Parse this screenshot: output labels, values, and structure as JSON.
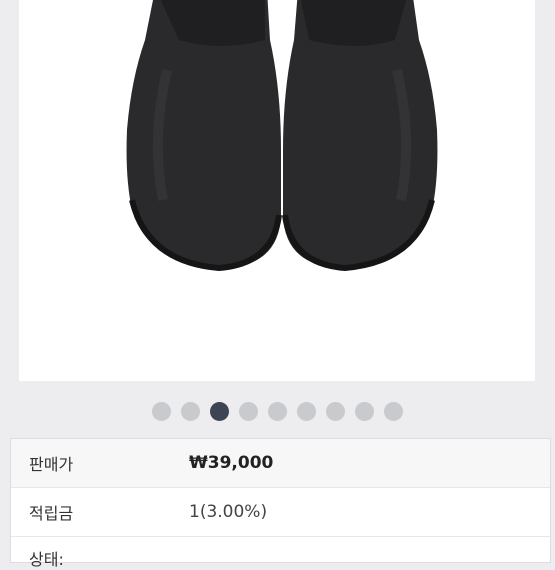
{
  "gallery": {
    "image_alt": "black chelsea boots, top view",
    "dot_count": 9,
    "active_index": 2
  },
  "product": {
    "price_label": "판매가",
    "price_value": "₩39,000",
    "points_label": "적립금",
    "points_value": "1(3.00%)",
    "status_label": "상태:"
  },
  "colors": {
    "active_dot": "#3d4454",
    "inactive_dot": "#c9cacd"
  }
}
